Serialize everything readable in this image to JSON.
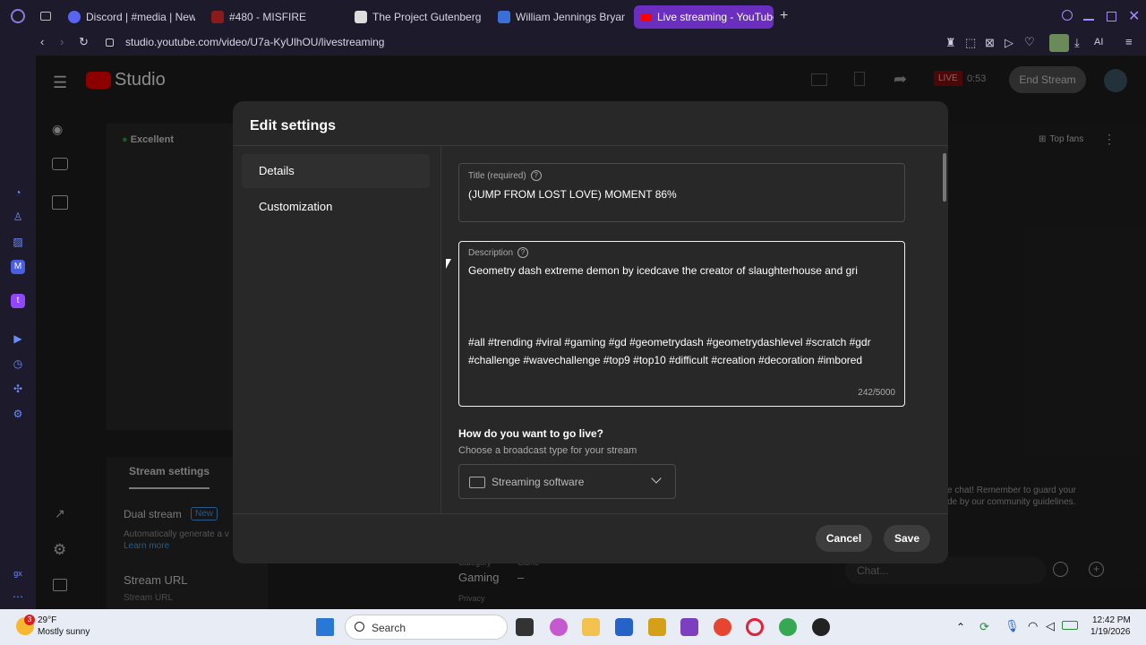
{
  "browser": {
    "tabs": [
      {
        "label": "Discord | #media | New Sp"
      },
      {
        "label": "#480 - MISFIRE"
      },
      {
        "label": "The Project Gutenberg eB"
      },
      {
        "label": "William Jennings Bryan, \"I"
      },
      {
        "label": "Live streaming - YouTube S"
      }
    ],
    "url": "studio.youtube.com/video/U7a-KyUlhOU/livestreaming",
    "ai_label": "AI"
  },
  "studio": {
    "logo": "Studio",
    "live_badge": "LIVE",
    "live_timer": "0:53",
    "end_stream": "End Stream",
    "connection": "Excellent",
    "top_fans": "Top fans",
    "stream_settings_tab": "Stream settings",
    "dual_stream": "Dual stream",
    "new_badge": "New",
    "dual_desc": "Automatically generate a v",
    "learn_more": "Learn more",
    "stream_url": "Stream URL",
    "stream_url_sub": "Stream URL",
    "category_label": "Category",
    "category_value": "Gaming",
    "game_label": "Game",
    "game_value": "–",
    "privacy_label": "Privacy",
    "chat_notice_1": "e chat! Remember to guard your",
    "chat_notice_2": "de by our community guidelines.",
    "chat_placeholder": "Chat..."
  },
  "modal": {
    "title": "Edit settings",
    "nav": [
      "Details",
      "Customization"
    ],
    "title_label": "Title (required)",
    "title_value": "(JUMP FROM LOST LOVE) MOMENT 86%",
    "desc_label": "Description",
    "desc_line1": "Geometry dash extreme demon by icedcave the creator of slaughterhouse and gri",
    "desc_tags1": "#all #trending #viral #gaming #gd #geometrydash #geometrydashlevel #scratch #gdr",
    "desc_tags2": "#challenge #wavechallenge #top9 #top10 #difficult #creation #decoration #imbored",
    "char_count": "242/5000",
    "golive_heading": "How do you want to go live?",
    "golive_sub": "Choose a broadcast type for your stream",
    "broadcast_type": "Streaming software",
    "cancel": "Cancel",
    "save": "Save"
  },
  "taskbar": {
    "temp": "29°F",
    "weather": "Mostly sunny",
    "weather_badge": "3",
    "search": "Search",
    "time": "12:42 PM",
    "date": "1/19/2026"
  }
}
